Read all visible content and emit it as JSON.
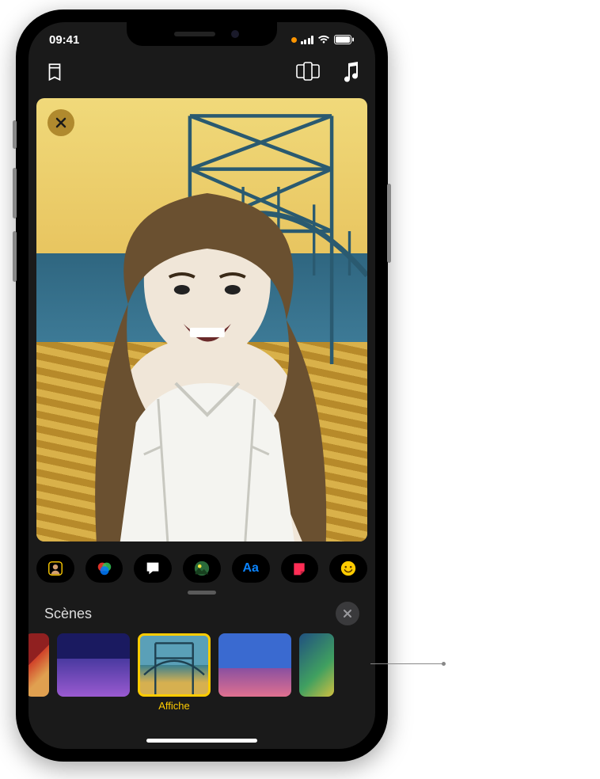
{
  "status": {
    "time": "09:41"
  },
  "toolbar": {
    "projects": "projects",
    "aspect": "aspect-ratio",
    "music": "music"
  },
  "viewer": {
    "close": "close"
  },
  "effects": {
    "items": [
      {
        "name": "memoji-button",
        "icon": "memoji"
      },
      {
        "name": "filters-button",
        "icon": "filters"
      },
      {
        "name": "live-titles-button",
        "icon": "speech"
      },
      {
        "name": "scenes-button",
        "icon": "landscape"
      },
      {
        "name": "text-button",
        "icon": "text",
        "label": "Aa"
      },
      {
        "name": "stickers-button",
        "icon": "sticker"
      },
      {
        "name": "emoji-button",
        "icon": "emoji"
      }
    ]
  },
  "panel": {
    "title": "Scènes",
    "close": "close",
    "selected_label": "Affiche",
    "thumbnails": [
      {
        "name": "scene-action",
        "css": "linear-gradient(135deg,#902020 40%,#d04028 40%,#e0a050 70%)"
      },
      {
        "name": "scene-city",
        "css": "linear-gradient(180deg,#1a1a60 40%,#4a3aa0 40%,#9a5ad0)"
      },
      {
        "name": "scene-affiche",
        "css": "linear-gradient(180deg,#5aa0b8 50%,#3a8090 50%,#d6b050 80%)",
        "selected": true,
        "label": "Affiche"
      },
      {
        "name": "scene-reef",
        "css": "linear-gradient(180deg,#3a6ad0 55%,#8a50a0 55%,#e07090)"
      },
      {
        "name": "scene-monsters",
        "css": "linear-gradient(135deg,#205080,#40a060 60%,#d0c040)"
      }
    ]
  }
}
